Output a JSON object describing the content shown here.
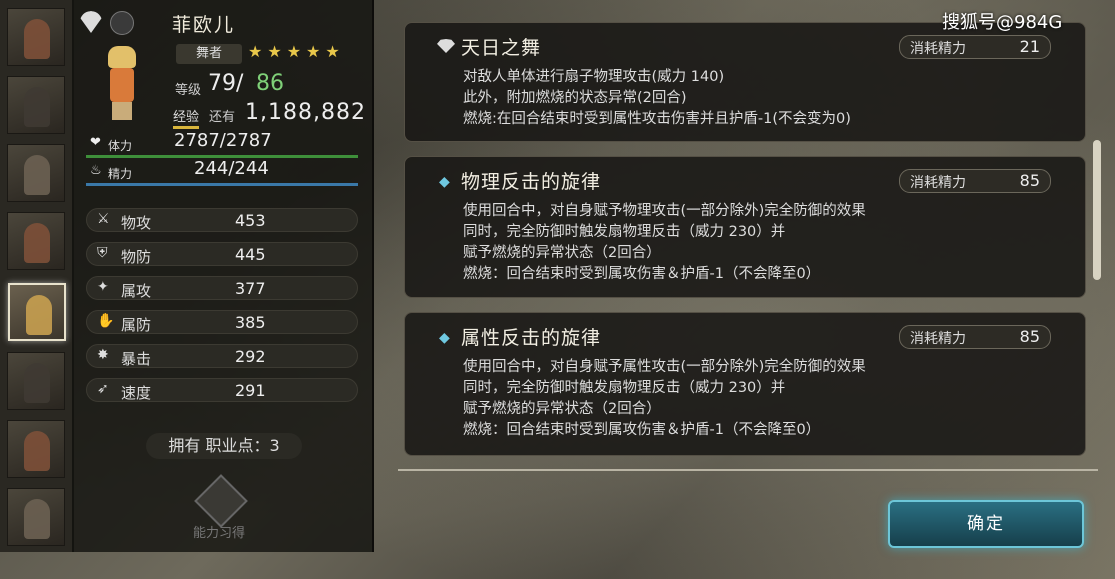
{
  "character": {
    "name": "菲欧儿",
    "job": "舞者",
    "stars": "★★★★★",
    "level_label": "等级",
    "level": "79",
    "level_sep": "/",
    "level_max": "86",
    "exp_label": "经验",
    "exp_remaining_label": "还有",
    "exp_value": "1,188,882",
    "hp_label": "体力",
    "hp_value": "2787/2787",
    "sp_label": "精力",
    "sp_value": "244/244",
    "stats": [
      {
        "label": "物攻",
        "value": "453",
        "icon": "sword-icon"
      },
      {
        "label": "物防",
        "value": "445",
        "icon": "shield-icon"
      },
      {
        "label": "属攻",
        "value": "377",
        "icon": "magic-icon"
      },
      {
        "label": "属防",
        "value": "385",
        "icon": "ward-icon"
      },
      {
        "label": "暴击",
        "value": "292",
        "icon": "crit-icon"
      },
      {
        "label": "速度",
        "value": "291",
        "icon": "boot-icon"
      }
    ],
    "job_points": "拥有 职业点：3",
    "ability_button": "能力习得"
  },
  "skills": [
    {
      "name": "天日之舞",
      "cost_label": "消耗精力",
      "cost": "21",
      "icon": "fan-icon",
      "desc": [
        "对敌人单体进行扇子物理攻击(威力 140)",
        "此外，附加燃烧的状态异常(2回合)",
        "燃烧:在回合结束时受到属性攻击伤害并且护盾-1(不会变为0)"
      ]
    },
    {
      "name": "物理反击的旋律",
      "cost_label": "消耗精力",
      "cost": "85",
      "icon": "diamond-icon",
      "desc": [
        "使用回合中，对自身赋予物理攻击(一部分除外)完全防御的效果",
        "同时，完全防御时触发扇物理反击（威力 230）并",
        "赋予燃烧的异常状态（2回合）",
        "燃烧：回合结束时受到属攻伤害＆护盾-1（不会降至0）"
      ]
    },
    {
      "name": "属性反击的旋律",
      "cost_label": "消耗精力",
      "cost": "85",
      "icon": "diamond-icon",
      "desc": [
        "使用回合中，对自身赋予属性攻击(一部分除外)完全防御的效果",
        "同时，完全防御时触发扇物理反击（威力 230）并",
        "赋予燃烧的异常状态（2回合）",
        "燃烧：回合结束时受到属攻伤害＆护盾-1（不会降至0）"
      ]
    }
  ],
  "confirm_label": "确定",
  "watermark": "搜狐号@984G",
  "colors": {
    "level_max": "#7fd078",
    "hp_bar": "#3e8f3a",
    "sp_bar": "#3a78a8",
    "confirm": "#2a6f82",
    "accent_icon": "#6fc8e0"
  },
  "hp_fill": 1.0,
  "sp_fill": 1.0
}
